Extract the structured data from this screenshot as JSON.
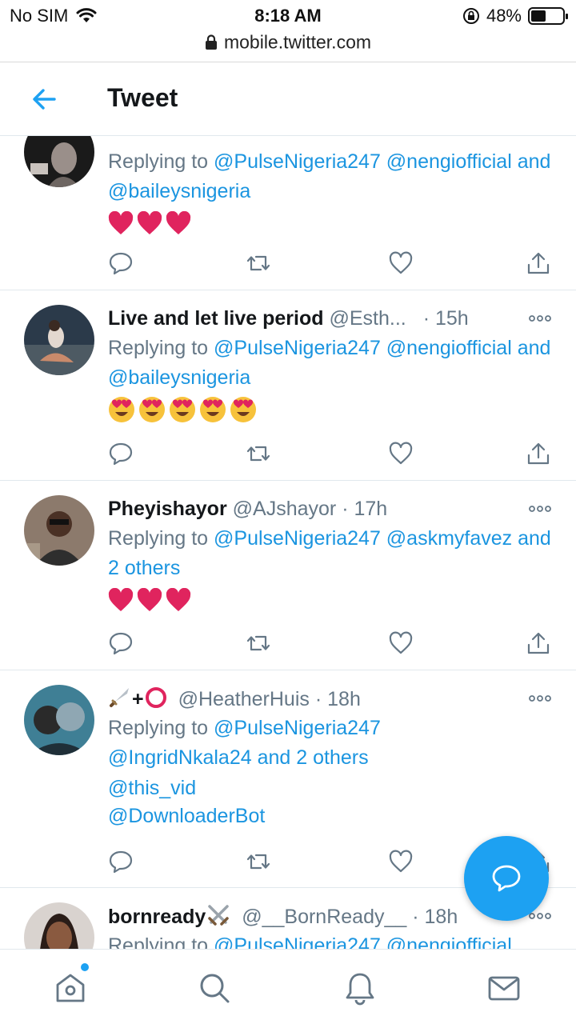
{
  "status_bar": {
    "carrier": "No SIM",
    "time": "8:18 AM",
    "battery": "48%",
    "battery_level": 0.48
  },
  "browser": {
    "url": "mobile.twitter.com"
  },
  "header": {
    "title": "Tweet"
  },
  "tweets": [
    {
      "name": "",
      "handle": "",
      "time": "",
      "reply_prefix": "Replying to",
      "reply_mentions": "@PulseNigeria247 @nengiofficial",
      "reply_tail_word": "and",
      "reply_tail_mention": "@baileysnigeria",
      "content_emoji": [
        "red-heart",
        "red-heart",
        "red-heart"
      ]
    },
    {
      "name": "Live and let live period",
      "handle": "@Esth...",
      "dot": "·",
      "time": "15h",
      "reply_prefix": "Replying to",
      "reply_mentions": "@PulseNigeria247 @nengiofficial",
      "reply_tail_word": "and",
      "reply_tail_mention": "@baileysnigeria",
      "content_emoji": [
        "heart-eyes",
        "heart-eyes",
        "heart-eyes",
        "heart-eyes",
        "heart-eyes"
      ]
    },
    {
      "name": "Pheyishayor",
      "handle": "@AJshayor",
      "dot": "·",
      "time": "17h",
      "reply_prefix": "Replying to",
      "reply_mentions": "@PulseNigeria247 @askmyfavez",
      "reply_tail_mention": "and 2 others",
      "content_emoji": [
        "red-heart",
        "red-heart",
        "red-heart"
      ]
    },
    {
      "name_symbol": "+",
      "handle": "@HeatherHuis",
      "dot": "·",
      "time": "18h",
      "reply_prefix": "Replying to",
      "reply_mention_1": "@PulseNigeria247",
      "reply_mention_2": "@IngridNkala24 and 2 others",
      "content_line_1": "@this_vid",
      "content_line_2": "@DownloaderBot"
    },
    {
      "name": "bornready",
      "handle": "@__BornReady__",
      "dot": "·",
      "time": "18h",
      "reply_prefix": "Replying to",
      "reply_mentions": "@PulseNigeria247 @nengiofficial"
    }
  ],
  "colors": {
    "accent": "#1da1f2",
    "link": "#1b95e0",
    "muted": "#657786",
    "heart": "#e0245e"
  }
}
